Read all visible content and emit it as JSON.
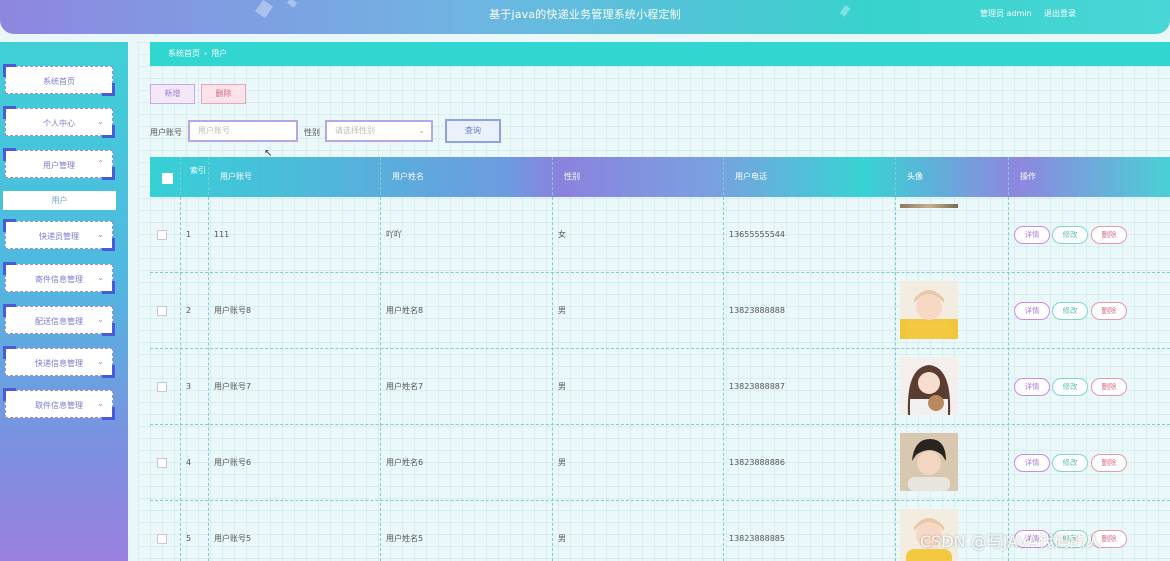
{
  "header": {
    "title": "基于java的快递业务管理系统小程定制",
    "user_label": "管理员 admin",
    "logout_label": "退出登录"
  },
  "sidebar": {
    "items": [
      {
        "label": "系统首页",
        "chevron": ""
      },
      {
        "label": "个人中心",
        "chevron": "⌄"
      },
      {
        "label": "用户管理",
        "chevron": "⌃"
      },
      {
        "label": "快递员管理",
        "chevron": "⌄"
      },
      {
        "label": "寄件信息管理",
        "chevron": "⌄"
      },
      {
        "label": "配送信息管理",
        "chevron": "⌄"
      },
      {
        "label": "快递信息管理",
        "chevron": "⌄"
      },
      {
        "label": "取件信息管理",
        "chevron": "⌄"
      }
    ],
    "sub_item": "用户"
  },
  "breadcrumb": {
    "home": "系统首页",
    "sep": "›",
    "current": "用户"
  },
  "toolbar": {
    "add_label": "新增",
    "delete_label": "删除"
  },
  "search": {
    "account_label": "用户账号",
    "account_placeholder": "用户账号",
    "gender_label": "性别",
    "gender_placeholder": "请选择性别",
    "query_label": "查询"
  },
  "table": {
    "headers": [
      "索引",
      "用户账号",
      "用户姓名",
      "性别",
      "用户电话",
      "头像",
      "操作"
    ],
    "rows": [
      {
        "index": "1",
        "account": "111",
        "name": "吖吖",
        "gender": "女",
        "phone": "13655555544"
      },
      {
        "index": "2",
        "account": "用户账号8",
        "name": "用户姓名8",
        "gender": "男",
        "phone": "13823888888"
      },
      {
        "index": "3",
        "account": "用户账号7",
        "name": "用户姓名7",
        "gender": "男",
        "phone": "13823888887"
      },
      {
        "index": "4",
        "account": "用户账号6",
        "name": "用户姓名6",
        "gender": "男",
        "phone": "13823888886"
      },
      {
        "index": "5",
        "account": "用户账号5",
        "name": "用户姓名5",
        "gender": "男",
        "phone": "13823888885"
      }
    ],
    "actions": {
      "detail": "详情",
      "edit": "修改",
      "delete": "删除"
    }
  },
  "watermark": "CSDN @写JAVA代码的人",
  "colors": {
    "accent": "#30d6cf",
    "purple": "#8f86e0"
  }
}
